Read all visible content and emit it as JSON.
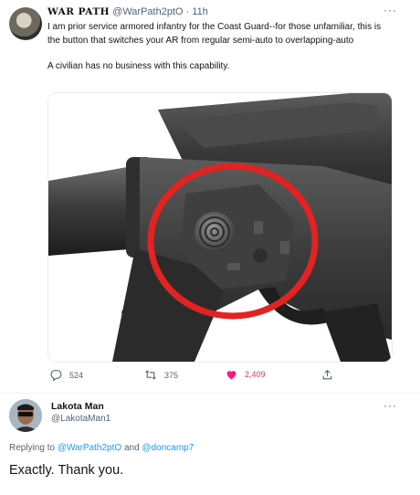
{
  "tweet1": {
    "display_name": "WAR PATH",
    "handle": "@WarPath2ptO",
    "separator": "·",
    "time": "11h",
    "more": "···",
    "text1": "I am prior service armored infantry for the Coast Guard--for those unfamiliar, this is the button that switches your AR from regular semi-auto to overlapping-auto",
    "text2": "A civilian has no business with this capability.",
    "image_alt": "AR lower receiver with the magazine release button circled in red",
    "actions": {
      "replies": "524",
      "retweets": "375",
      "likes": "2,409"
    },
    "colors": {
      "like": "#f91880",
      "circle": "#e32222"
    }
  },
  "tweet2": {
    "display_name": "Lakota Man",
    "handle": "@LakotaMan1",
    "more": "···",
    "replying_prefix": "Replying to",
    "replying_user1": "@WarPath2ptO",
    "replying_and": "and",
    "replying_user2": "@doncamp7",
    "text": "Exactly. Thank you."
  },
  "icons": [
    "reply-icon",
    "retweet-icon",
    "like-icon",
    "share-icon",
    "more-icon"
  ]
}
